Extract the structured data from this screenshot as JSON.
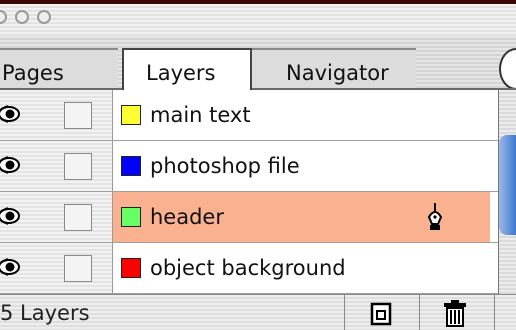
{
  "window": {
    "buttons": [
      "close",
      "minimize",
      "zoom"
    ]
  },
  "tabs": [
    {
      "label": "Pages",
      "active": false
    },
    {
      "label": "Layers",
      "active": true
    },
    {
      "label": "Navigator",
      "active": false
    }
  ],
  "layers": [
    {
      "name": "main text",
      "color": "#ffff33",
      "visible": true,
      "selected": false
    },
    {
      "name": "photoshop file",
      "color": "#0000ff",
      "visible": true,
      "selected": false
    },
    {
      "name": "header",
      "color": "#66ff66",
      "visible": true,
      "selected": true,
      "icon": "pen-icon"
    },
    {
      "name": "object background",
      "color": "#ff0000",
      "visible": true,
      "selected": false
    }
  ],
  "status": {
    "count_text": "5 Layers",
    "new_layer_icon": "new-layer-icon",
    "delete_icon": "trash-icon"
  },
  "colors": {
    "selection": "#f9b190",
    "scroll_thumb": "#3d78cf"
  }
}
